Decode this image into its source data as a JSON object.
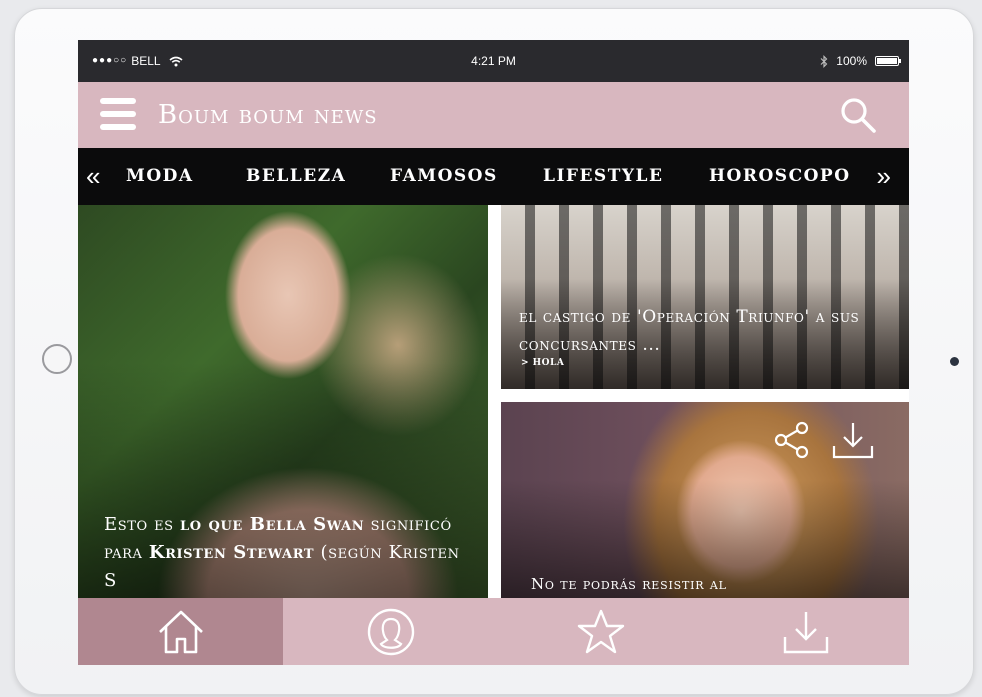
{
  "status_bar": {
    "carrier": "BELL",
    "signal_dots": "●●●○○",
    "time": "4:21 PM",
    "battery": "100%"
  },
  "header": {
    "brand": "Boum boum news",
    "menu_icon": "hamburger-icon",
    "search_icon": "search-icon",
    "color": "#d8b7bf"
  },
  "categories": {
    "items": [
      "MODA",
      "BELLEZA",
      "FAMOSOS",
      "LIFESTYLE",
      "HOROSCOPO"
    ],
    "prev": "«",
    "next": "»"
  },
  "articles": {
    "featured": {
      "title_parts": [
        {
          "text": "Esto es ",
          "bold": false
        },
        {
          "text": "lo que Bella Swan",
          "bold": true
        },
        {
          "text": " significó para ",
          "bold": false
        },
        {
          "text": "Kristen Stewart",
          "bold": true
        },
        {
          "text": " (según Kristen S",
          "bold": false
        }
      ]
    },
    "top_right": {
      "title": "el castigo de 'Operación Triunfo' a sus concursantes ...",
      "source": "> HOLA"
    },
    "bottom_right": {
      "title": "No te podrás resistir al",
      "share_icon": "share-icon",
      "download_icon": "download-icon"
    }
  },
  "tabbar": {
    "tabs": [
      {
        "name": "home",
        "icon": "home-icon",
        "active": true
      },
      {
        "name": "profile",
        "icon": "profile-icon",
        "active": false
      },
      {
        "name": "favorites",
        "icon": "star-icon",
        "active": false
      },
      {
        "name": "downloads",
        "icon": "download-icon",
        "active": false
      }
    ],
    "active_color": "#b08790",
    "color": "#d8b7bf"
  }
}
